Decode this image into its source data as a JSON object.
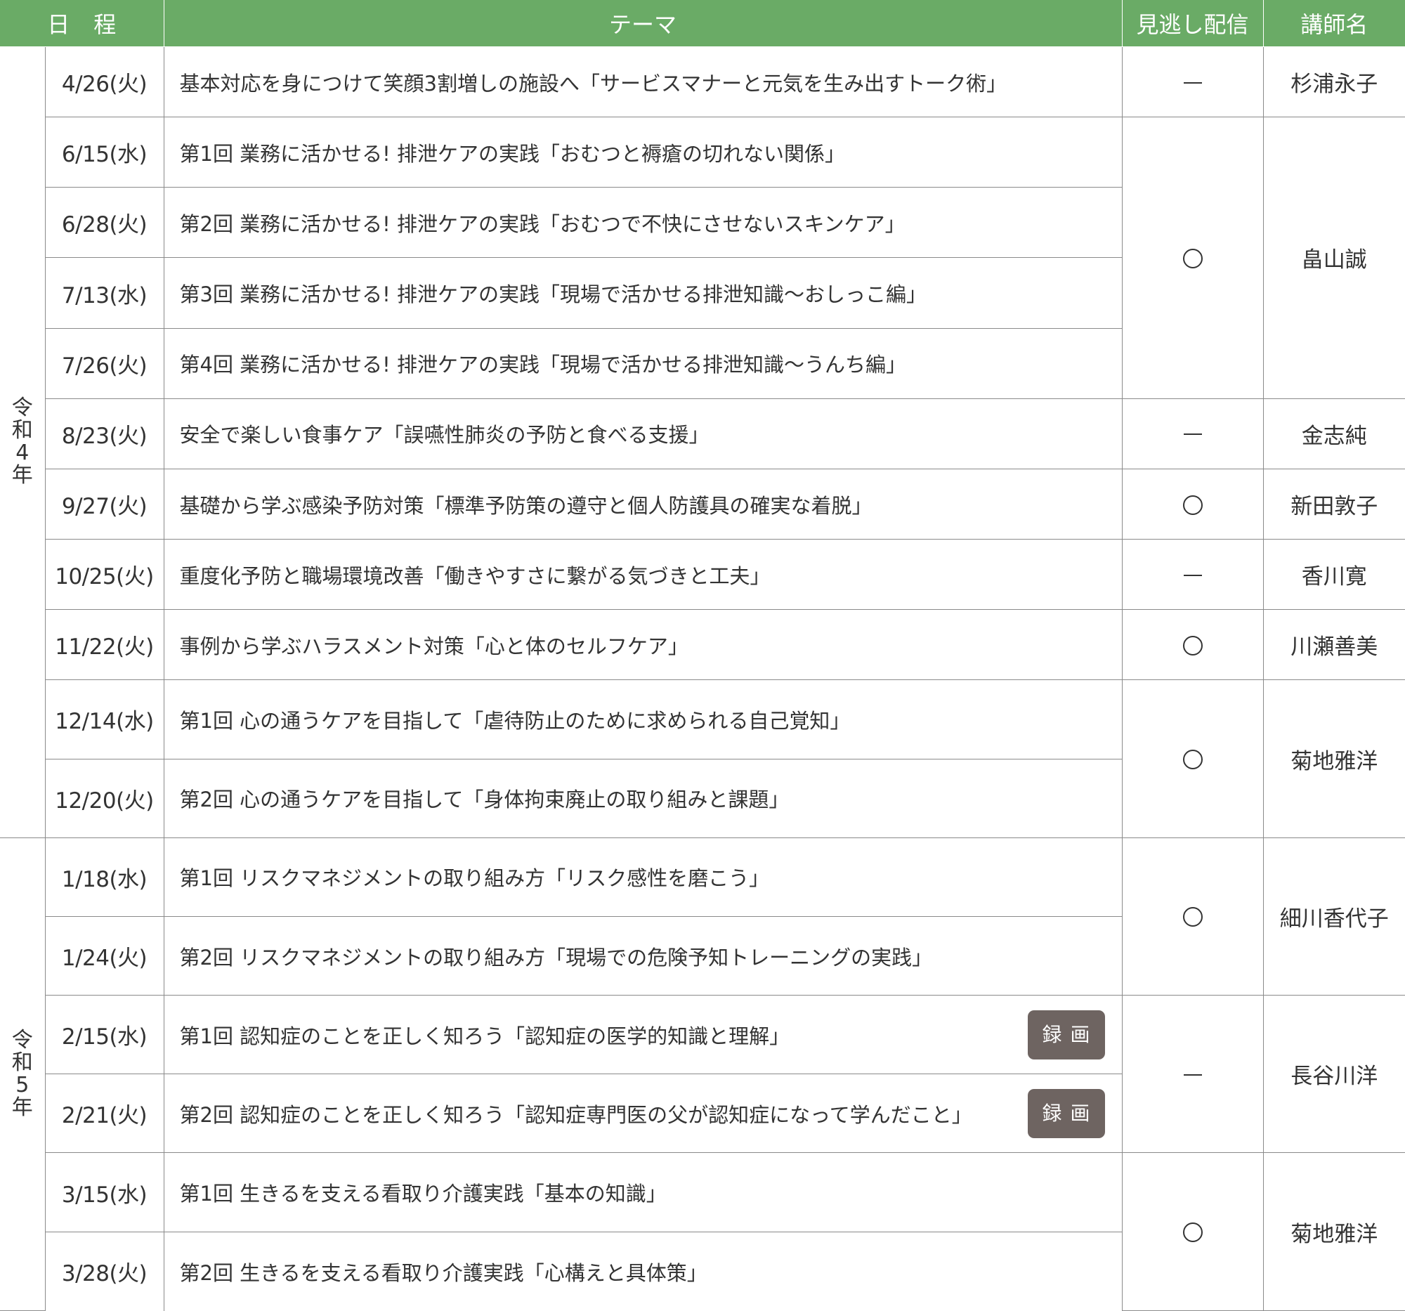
{
  "header": {
    "date": "日程",
    "theme": "テーマ",
    "missed": "見逃し配信",
    "lecturer": "講師名"
  },
  "era": {
    "r4": [
      "令",
      "和",
      "4",
      "年"
    ],
    "r5": [
      "令",
      "和",
      "5",
      "年"
    ]
  },
  "rows": [
    {
      "date": "4/26(火)",
      "theme": "基本対応を身につけて笑顔3割増しの施設へ「サービスマナーと元気を生み出すトーク術」"
    },
    {
      "date": "6/15(水)",
      "theme": "第1回 業務に活かせる! 排泄ケアの実践「おむつと褥瘡の切れない関係」"
    },
    {
      "date": "6/28(火)",
      "theme": "第2回 業務に活かせる! 排泄ケアの実践「おむつで不快にさせないスキンケア」"
    },
    {
      "date": "7/13(水)",
      "theme": "第3回 業務に活かせる! 排泄ケアの実践「現場で活かせる排泄知識〜おしっこ編」"
    },
    {
      "date": "7/26(火)",
      "theme": "第4回 業務に活かせる! 排泄ケアの実践「現場で活かせる排泄知識〜うんち編」"
    },
    {
      "date": "8/23(火)",
      "theme": "安全で楽しい食事ケア「誤嚥性肺炎の予防と食べる支援」"
    },
    {
      "date": "9/27(火)",
      "theme": "基礎から学ぶ感染予防対策「標準予防策の遵守と個人防護具の確実な着脱」"
    },
    {
      "date": "10/25(火)",
      "theme": "重度化予防と職場環境改善「働きやすさに繋がる気づきと工夫」"
    },
    {
      "date": "11/22(火)",
      "theme": "事例から学ぶハラスメント対策「心と体のセルフケア」"
    },
    {
      "date": "12/14(水)",
      "theme": "第1回 心の通うケアを目指して「虐待防止のために求められる自己覚知」"
    },
    {
      "date": "12/20(火)",
      "theme": "第2回 心の通うケアを目指して「身体拘束廃止の取り組みと課題」"
    },
    {
      "date": "1/18(水)",
      "theme": "第1回 リスクマネジメントの取り組み方「リスク感性を磨こう」"
    },
    {
      "date": "1/24(火)",
      "theme": "第2回 リスクマネジメントの取り組み方「現場での危険予知トレーニングの実践」"
    },
    {
      "date": "2/15(水)",
      "theme": "第1回 認知症のことを正しく知ろう「認知症の医学的知識と理解」",
      "badge": "録画"
    },
    {
      "date": "2/21(火)",
      "theme": "第2回 認知症のことを正しく知ろう「認知症専門医の父が認知症になって学んだこと」",
      "badge": "録画"
    },
    {
      "date": "3/15(水)",
      "theme": "第1回 生きるを支える看取り介護実践「基本の知識」"
    },
    {
      "date": "3/28(火)",
      "theme": "第2回 生きるを支える看取り介護実践「心構えと具体策」"
    }
  ],
  "groups": [
    {
      "missed": "dash",
      "lecturer": "杉浦永子"
    },
    {
      "missed": "circle",
      "lecturer": "畠山誠"
    },
    {
      "missed": "dash",
      "lecturer": "金志純"
    },
    {
      "missed": "circle",
      "lecturer": "新田敦子"
    },
    {
      "missed": "dash",
      "lecturer": "香川寛"
    },
    {
      "missed": "circle",
      "lecturer": "川瀬善美"
    },
    {
      "missed": "circle",
      "lecturer": "菊地雅洋"
    },
    {
      "missed": "circle",
      "lecturer": "細川香代子"
    },
    {
      "missed": "dash",
      "lecturer": "長谷川洋"
    },
    {
      "missed": "circle",
      "lecturer": "菊地雅洋"
    }
  ]
}
